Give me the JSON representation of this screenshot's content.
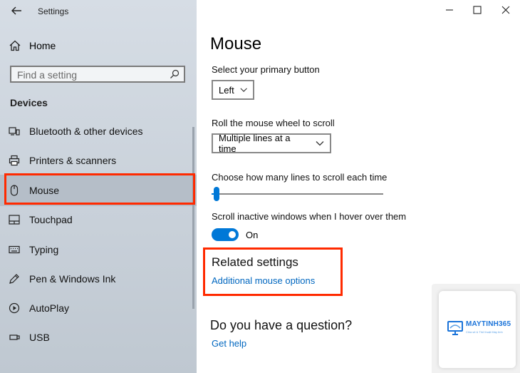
{
  "window": {
    "title": "Settings"
  },
  "sidebar": {
    "home_label": "Home",
    "search_placeholder": "Find a setting",
    "section_title": "Devices",
    "items": [
      {
        "label": "Bluetooth & other devices",
        "icon": "bluetooth-devices-icon"
      },
      {
        "label": "Printers & scanners",
        "icon": "printer-icon"
      },
      {
        "label": "Mouse",
        "icon": "mouse-icon",
        "selected": true
      },
      {
        "label": "Touchpad",
        "icon": "touchpad-icon"
      },
      {
        "label": "Typing",
        "icon": "keyboard-icon"
      },
      {
        "label": "Pen & Windows Ink",
        "icon": "pen-icon"
      },
      {
        "label": "AutoPlay",
        "icon": "autoplay-icon"
      },
      {
        "label": "USB",
        "icon": "usb-icon"
      }
    ]
  },
  "main": {
    "title": "Mouse",
    "primary_button": {
      "label": "Select your primary button",
      "value": "Left"
    },
    "scroll_wheel": {
      "label": "Roll the mouse wheel to scroll",
      "value": "Multiple lines at a time"
    },
    "lines_slider": {
      "label": "Choose how many lines to scroll each time",
      "fraction": 0.03
    },
    "inactive_scroll": {
      "label": "Scroll inactive windows when I hover over them",
      "state": "On",
      "on": true
    },
    "related": {
      "title": "Related settings",
      "link": "Additional mouse options"
    },
    "question": {
      "title": "Do you have a question?",
      "link": "Get help"
    }
  },
  "watermark": {
    "brand": "MAYTINH365",
    "tagline": "Chia sẻ & Thủ thuật Máy tính"
  },
  "colors": {
    "accent": "#0078d7",
    "link": "#0067c0",
    "highlight": "#ff2a00"
  }
}
